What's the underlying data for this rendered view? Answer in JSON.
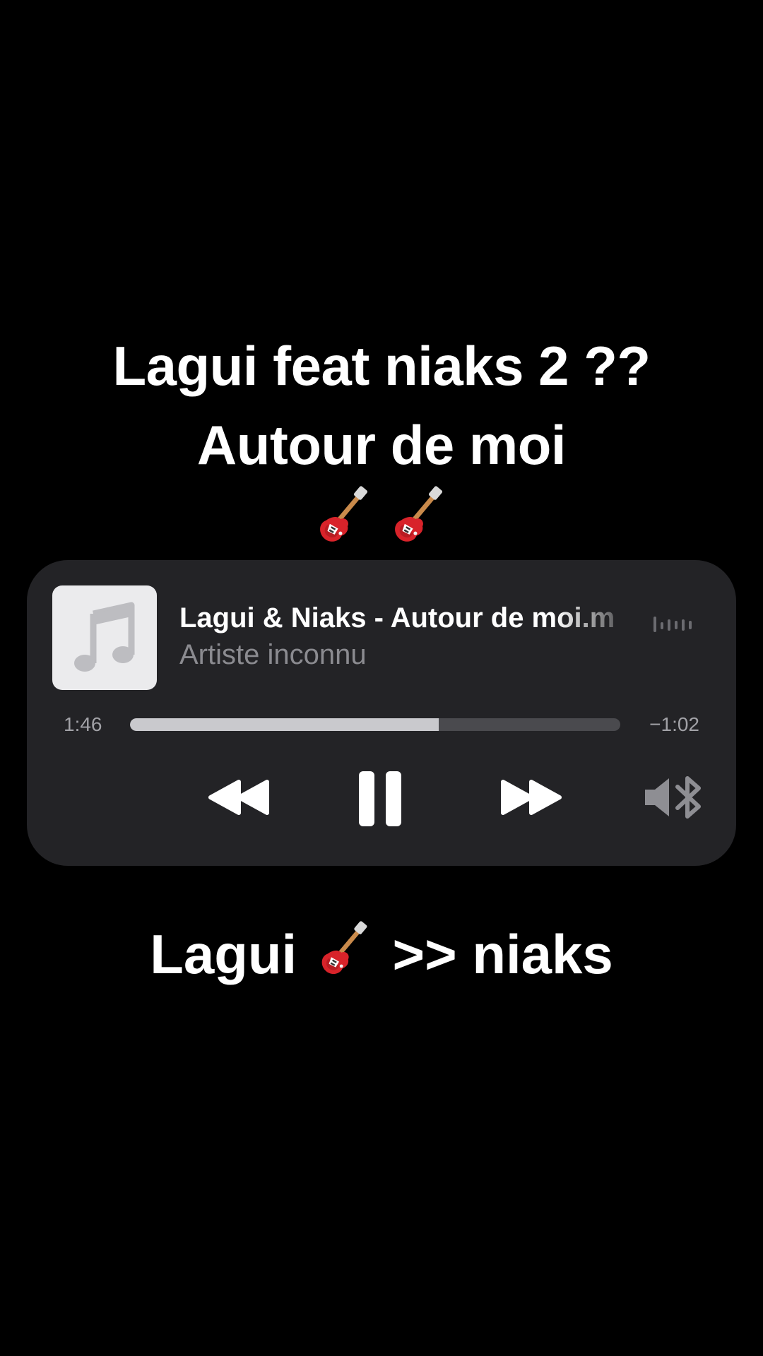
{
  "caption_top": {
    "line1": "Lagui feat niaks 2 ??",
    "line2": "Autour de moi",
    "emoji_icons": [
      "guitar-icon",
      "guitar-icon"
    ]
  },
  "player": {
    "artwork_icon": "music-note-icon",
    "title": "Lagui & Niaks - Autour de moi.m",
    "artist": "Artiste inconnu",
    "elapsed": "1:46",
    "remaining": "−1:02",
    "progress_fraction": 0.63,
    "controls": {
      "rewind_icon": "rewind-icon",
      "pause_icon": "pause-icon",
      "forward_icon": "fast-forward-icon",
      "audio_output_icon": "speaker-bluetooth-icon",
      "waveform_icon": "waveform-icon"
    }
  },
  "caption_bottom": {
    "before": "Lagui",
    "emoji_icon": "guitar-icon",
    "after": ">> niaks"
  },
  "colors": {
    "background": "#000000",
    "card": "#232326",
    "progress_fill": "#c9c9cd",
    "progress_track": "#4a4a4e",
    "secondary_text": "#8b8b90"
  }
}
